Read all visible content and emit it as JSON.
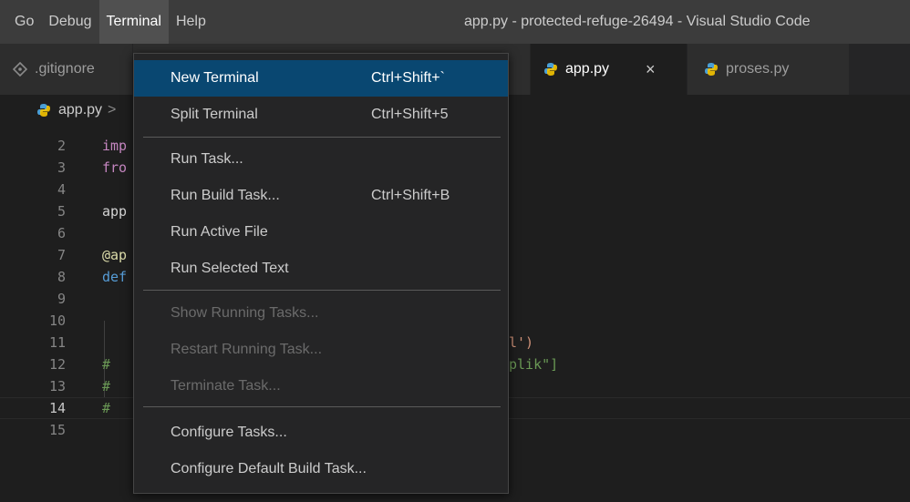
{
  "menubar": {
    "items": [
      "Go",
      "Debug",
      "Terminal",
      "Help"
    ],
    "active": "Terminal"
  },
  "window_title": "app.py - protected-refuge-26494 - Visual Studio Code",
  "tabs": [
    {
      "label": ".gitignore",
      "icon": "git-icon"
    },
    {
      "label": "app.py",
      "icon": "python-icon",
      "active": true,
      "close": "×"
    },
    {
      "label": "proses.py",
      "icon": "python-icon"
    }
  ],
  "breadcrumb": {
    "file": "app.py",
    "sep": ">"
  },
  "editor": {
    "current_line": 14,
    "lines": [
      {
        "n": "2",
        "code": "imp"
      },
      {
        "n": "3",
        "code": "fro"
      },
      {
        "n": "4",
        "code": ""
      },
      {
        "n": "5",
        "code": "app"
      },
      {
        "n": "6",
        "code": ""
      },
      {
        "n": "7",
        "code": "@ap"
      },
      {
        "n": "8",
        "code": "def"
      },
      {
        "n": "9",
        "code": ""
      },
      {
        "n": "10",
        "code": ""
      },
      {
        "n": "11",
        "code": "l')"
      },
      {
        "n": "12",
        "code": "#",
        "code2": "plik\"]"
      },
      {
        "n": "13",
        "code": "#"
      },
      {
        "n": "14",
        "code": "#"
      },
      {
        "n": "15",
        "code": ""
      }
    ]
  },
  "terminal_menu": {
    "items": [
      {
        "label": "New Terminal",
        "shortcut": "Ctrl+Shift+`",
        "highlight": true
      },
      {
        "label": "Split Terminal",
        "shortcut": "Ctrl+Shift+5"
      },
      {
        "label": "Run Task...",
        "shortcut": ""
      },
      {
        "label": "Run Build Task...",
        "shortcut": "Ctrl+Shift+B"
      },
      {
        "label": "Run Active File",
        "shortcut": ""
      },
      {
        "label": "Run Selected Text",
        "shortcut": ""
      },
      {
        "label": "Show Running Tasks...",
        "shortcut": "",
        "disabled": true
      },
      {
        "label": "Restart Running Task...",
        "shortcut": "",
        "disabled": true
      },
      {
        "label": "Terminate Task...",
        "shortcut": "",
        "disabled": true
      },
      {
        "label": "Configure Tasks...",
        "shortcut": ""
      },
      {
        "label": "Configure Default Build Task...",
        "shortcut": ""
      }
    ]
  },
  "colors": {
    "titlebar": "#3c3c3c",
    "highlight": "#094771",
    "editor_bg": "#1e1e1e",
    "python_icon": "#4a9fd6"
  }
}
